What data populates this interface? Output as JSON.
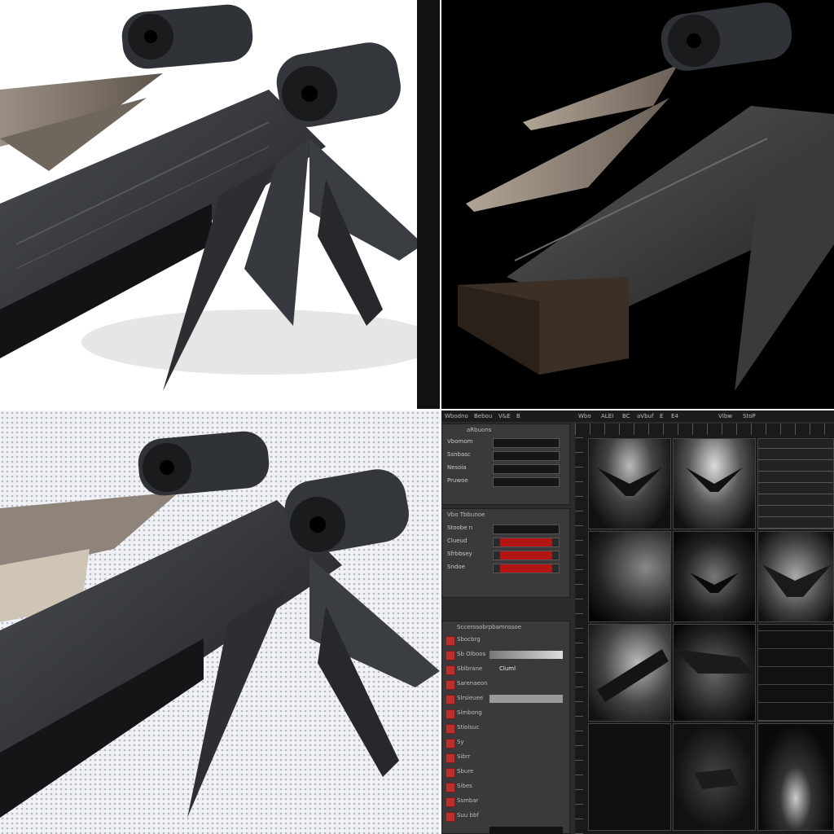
{
  "colors": {
    "hull_dark": "#2a2c30",
    "hull_mid": "#3c3f44",
    "fin_tan": "#8a7e72",
    "panel_bg": "#3a3a3a",
    "accent_red": "#b31515",
    "accent_blue": "#3b78c2"
  },
  "software": {
    "menu_left": [
      "Wbodno",
      "Bebou",
      "V&E",
      "B"
    ],
    "menu_right": [
      "Wbo",
      "ALEI",
      "BC",
      "aVbuf",
      "E",
      "E4",
      "VIbw",
      "StoP"
    ],
    "panel1_tab": "aRbuons",
    "panel1_rows": [
      {
        "label": "Vbomom",
        "value": ""
      },
      {
        "label": "Ssnbasc",
        "value": ""
      },
      {
        "label": "Nesoia",
        "value": ""
      },
      {
        "label": "Pruwoe",
        "value": ""
      }
    ],
    "panel2_title": "Vbo Tbbunoe",
    "panel2_rows": [
      {
        "label": "Stoobe n",
        "value": "S"
      },
      {
        "label": "Clueud",
        "value": "S"
      },
      {
        "label": "Sfrbbsey",
        "value": "S"
      },
      {
        "label": "Sndoe",
        "value": "S"
      }
    ],
    "panel3_title": "Sccerosobrpbamnssoe",
    "panel3_rows": [
      {
        "label": "Sbocbrg",
        "value": ""
      },
      {
        "label": "Sb Olboos",
        "value": ""
      },
      {
        "label": "Sblbrane",
        "value": "Cluml"
      },
      {
        "label": "Sarenaeon",
        "value": ""
      },
      {
        "label": "Slrsieuee",
        "value": ""
      },
      {
        "label": "Slmbong",
        "value": ""
      },
      {
        "label": "Stiolsuc",
        "value": ""
      },
      {
        "label": "Sy",
        "value": ""
      },
      {
        "label": "Sibrr",
        "value": ""
      },
      {
        "label": "Sbure",
        "value": ""
      },
      {
        "label": "Sibes",
        "value": ""
      },
      {
        "label": "Ssmbar",
        "value": ""
      },
      {
        "label": "Suu bbf",
        "value": ""
      }
    ]
  }
}
